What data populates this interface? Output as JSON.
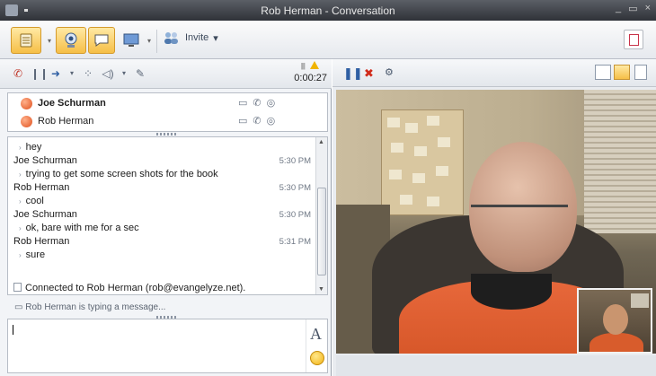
{
  "window": {
    "title": "Rob Herman - Conversation",
    "controls": [
      "_",
      "▭",
      "×"
    ]
  },
  "toolbar": {
    "invite_label": "Invite"
  },
  "call": {
    "timer": "0:00:27"
  },
  "participants": [
    {
      "name": "Joe Schurman",
      "bold": true
    },
    {
      "name": "Rob Herman",
      "bold": false
    }
  ],
  "chat": {
    "messages": [
      {
        "kind": "text",
        "text": "hey"
      },
      {
        "kind": "sender",
        "text": "Joe Schurman",
        "time": "5:30 PM"
      },
      {
        "kind": "text",
        "text": "trying to get some screen shots for the book"
      },
      {
        "kind": "sender",
        "text": "Rob Herman",
        "time": "5:30 PM"
      },
      {
        "kind": "text",
        "text": "cool"
      },
      {
        "kind": "sender",
        "text": "Joe Schurman",
        "time": "5:30 PM"
      },
      {
        "kind": "text",
        "text": "ok, bare with me for a sec"
      },
      {
        "kind": "sender",
        "text": "Rob Herman",
        "time": "5:31 PM"
      },
      {
        "kind": "text",
        "text": "sure"
      }
    ],
    "connected_text": "Connected to Rob Herman (rob@evangelyze.net).",
    "typing_text": "Rob Herman is typing a message..."
  },
  "compose": {
    "font_button": "A"
  },
  "icons": {
    "app": "conversation-window-icon",
    "contacts": "contact-list-icon",
    "video": "webcam-icon",
    "im": "instant-message-icon",
    "share": "desktop-share-icon",
    "invite": "add-people-icon",
    "notes": "notes-icon",
    "hangup": "end-call-icon",
    "hold": "hold-icon",
    "transfer": "transfer-icon",
    "dialpad": "dialpad-icon",
    "volume": "speaker-icon",
    "mic": "microphone-icon",
    "pause": "pause-video-icon",
    "stop": "stop-video-icon",
    "camera-settings": "camera-settings-icon",
    "emoticon": "emoticon-icon"
  },
  "colors": {
    "active_button": "#f6bf47",
    "presence": "#e0501e",
    "titlebar": "#3b3e44"
  }
}
